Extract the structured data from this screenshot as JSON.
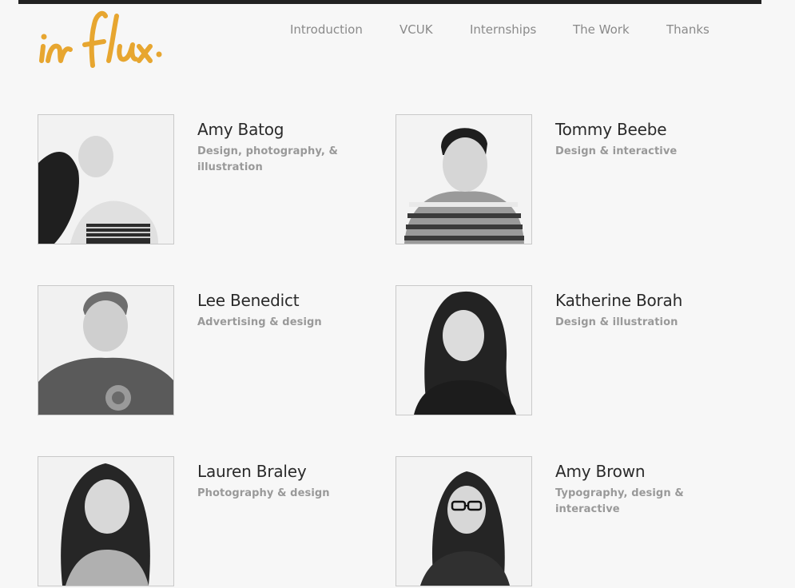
{
  "brand": {
    "logo_text": "in flux.",
    "accent": "#e7a630"
  },
  "nav": {
    "items": [
      {
        "label": "Introduction"
      },
      {
        "label": "VCUK"
      },
      {
        "label": "Internships"
      },
      {
        "label": "The Work"
      },
      {
        "label": "Thanks"
      }
    ]
  },
  "people": [
    {
      "name": "Amy Batog",
      "role": "Design, photography, & illustration"
    },
    {
      "name": "Tommy Beebe",
      "role": "Design & interactive"
    },
    {
      "name": "Lee Benedict",
      "role": "Advertising & design"
    },
    {
      "name": "Katherine Borah",
      "role": "Design & illustration"
    },
    {
      "name": "Lauren Braley",
      "role": "Photography & design"
    },
    {
      "name": "Amy Brown",
      "role": "Typography, design & interactive"
    }
  ]
}
